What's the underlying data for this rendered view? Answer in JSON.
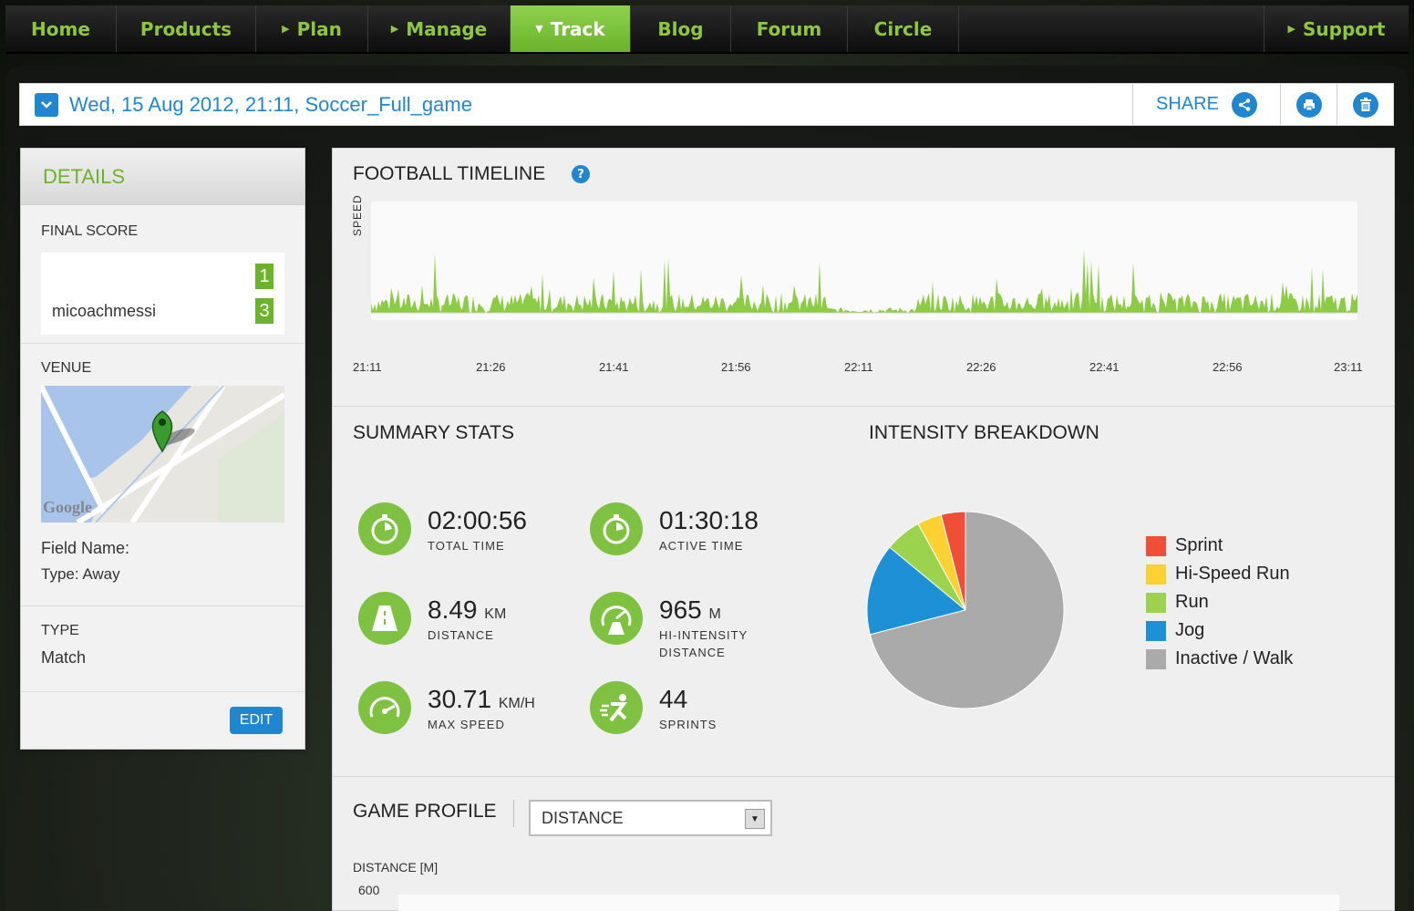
{
  "nav": {
    "items": [
      {
        "label": "Home",
        "arrow": false,
        "active": false
      },
      {
        "label": "Products",
        "arrow": false,
        "active": false
      },
      {
        "label": "Plan",
        "arrow": true,
        "active": false
      },
      {
        "label": "Manage",
        "arrow": true,
        "active": false
      },
      {
        "label": "Track",
        "arrow": true,
        "active": true
      },
      {
        "label": "Blog",
        "arrow": false,
        "active": false
      },
      {
        "label": "Forum",
        "arrow": false,
        "active": false
      },
      {
        "label": "Circle",
        "arrow": false,
        "active": false
      }
    ],
    "support": "Support"
  },
  "session": {
    "title": "Wed, 15 Aug 2012, 21:11, Soccer_Full_game",
    "share_label": "SHARE"
  },
  "details": {
    "heading": "DETAILS",
    "final_score_label": "FINAL SCORE",
    "score_top": "1",
    "score_bottom": "3",
    "team_name": "micoachmessi",
    "venue_label": "VENUE",
    "map_brand": "Google",
    "field_name": "Field Name:",
    "field_type": "Type: Away",
    "type_label": "TYPE",
    "type_value": "Match",
    "edit_label": "EDIT"
  },
  "timeline": {
    "title": "FOOTBALL TIMELINE",
    "help": "?",
    "y_label": "SPEED",
    "ticks": [
      "21:11",
      "21:26",
      "21:41",
      "21:56",
      "22:11",
      "22:26",
      "22:41",
      "22:56",
      "23:11"
    ]
  },
  "summary": {
    "title": "SUMMARY STATS",
    "stats": [
      {
        "value": "02:00:56",
        "unit": "",
        "label": "TOTAL TIME",
        "label2": ""
      },
      {
        "value": "01:30:18",
        "unit": "",
        "label": "ACTIVE TIME",
        "label2": ""
      },
      {
        "value": "8.49",
        "unit": "KM",
        "label": "DISTANCE",
        "label2": ""
      },
      {
        "value": "965",
        "unit": "M",
        "label": "HI-INTENSITY",
        "label2": "DISTANCE"
      },
      {
        "value": "30.71",
        "unit": "KM/H",
        "label": "MAX SPEED",
        "label2": ""
      },
      {
        "value": "44",
        "unit": "",
        "label": "SPRINTS",
        "label2": ""
      }
    ]
  },
  "intensity": {
    "title": "INTENSITY BREAKDOWN"
  },
  "chart_data": {
    "type": "pie",
    "title": "INTENSITY BREAKDOWN",
    "categories": [
      "Sprint",
      "Hi-Speed Run",
      "Run",
      "Jog",
      "Inactive / Walk"
    ],
    "values": [
      4,
      4,
      6,
      15,
      71
    ],
    "colors": [
      "#f04e37",
      "#fcd232",
      "#9bd34e",
      "#1e90d6",
      "#aaaaaa"
    ],
    "legend": "right"
  },
  "profile": {
    "title": "GAME PROFILE",
    "selected": "DISTANCE",
    "axis_label": "DISTANCE [M]",
    "y_top": "600"
  },
  "colors": {
    "brand_green": "#7fc241",
    "accent_blue": "#1f86cf"
  }
}
